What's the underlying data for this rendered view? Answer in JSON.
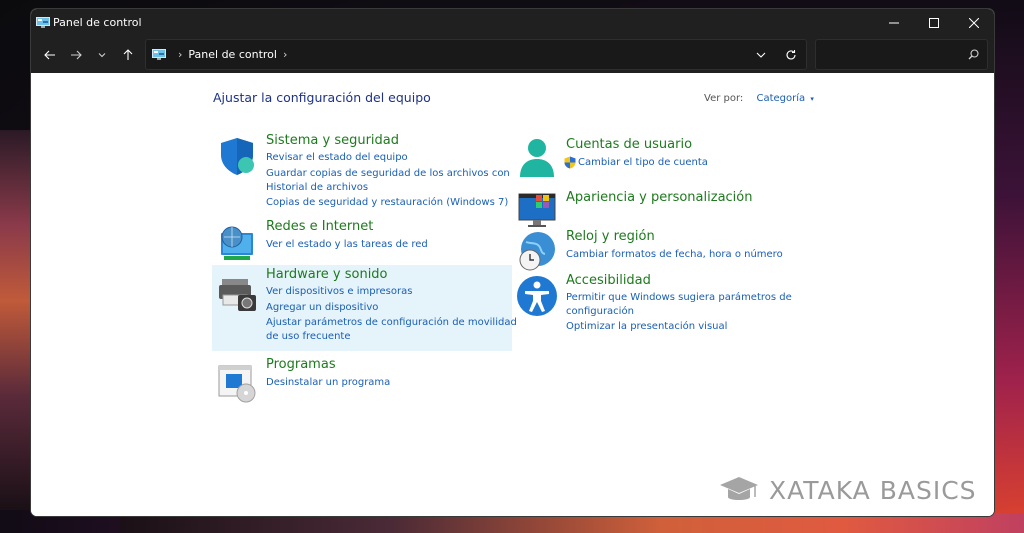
{
  "window": {
    "title": "Panel de control"
  },
  "address": {
    "crumb": "Panel de control",
    "search_placeholder": ""
  },
  "header": {
    "title": "Ajustar la configuración del equipo",
    "view_by_label": "Ver por:",
    "view_by_value": "Categoría"
  },
  "categories": {
    "system": {
      "title": "Sistema y seguridad",
      "links": [
        "Revisar el estado del equipo",
        "Guardar copias de seguridad de los archivos con",
        "Historial de archivos",
        "Copias de seguridad y restauración (Windows 7)"
      ]
    },
    "network": {
      "title": "Redes e Internet",
      "links": [
        "Ver el estado y las tareas de red"
      ]
    },
    "hardware": {
      "title": "Hardware y sonido",
      "links": [
        "Ver dispositivos e impresoras",
        "Agregar un dispositivo",
        "Ajustar parámetros de configuración de movilidad",
        "de uso frecuente"
      ]
    },
    "programs": {
      "title": "Programas",
      "links": [
        "Desinstalar un programa"
      ]
    },
    "accounts": {
      "title": "Cuentas de usuario",
      "links": [
        "Cambiar el tipo de cuenta"
      ]
    },
    "appearance": {
      "title": "Apariencia y personalización",
      "links": []
    },
    "clock": {
      "title": "Reloj y región",
      "links": [
        "Cambiar formatos de fecha, hora o número"
      ]
    },
    "access": {
      "title": "Accesibilidad",
      "links": [
        "Permitir que Windows sugiera parámetros de",
        "configuración",
        "Optimizar la presentación visual"
      ]
    }
  },
  "watermark": "XATAKA BASICS",
  "colors": {
    "title_green": "#1e7a1e",
    "link_blue": "#1a5fb4",
    "header_blue": "#1e3287",
    "highlight": "#e5f3fb",
    "chrome": "#202020"
  }
}
